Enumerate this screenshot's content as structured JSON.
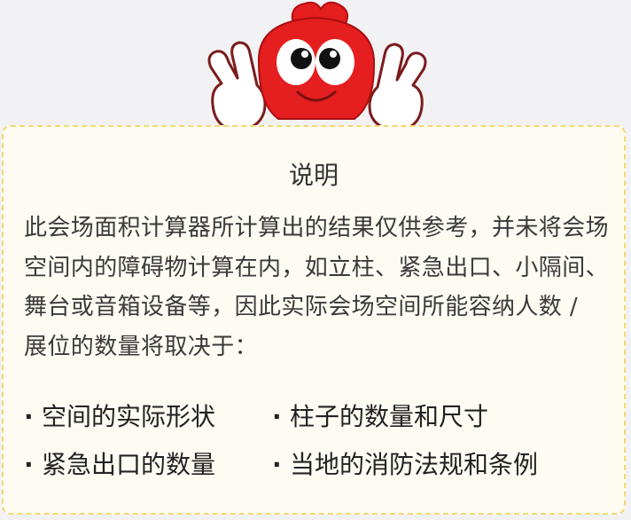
{
  "notice": {
    "title": "说明",
    "body": "此会场面积计算器所计算出的结果仅供参考，并未将会场空间内的障碍物计算在内，如立柱、紧急出口、小隔间、舞台或音箱设备等，因此实际会场空间所能容纳人数 / 展位的数量将取决于：",
    "bullet_glyph": "·",
    "factors": [
      "空间的实际形状",
      "柱子的数量和尺寸",
      "紧急出口的数量",
      "当地的消防法规和条例"
    ]
  },
  "colors": {
    "background": "#f2f2f5",
    "card_fill": "#fefcf2",
    "card_border": "#f3d870",
    "mascot_red": "#e51e1f"
  }
}
